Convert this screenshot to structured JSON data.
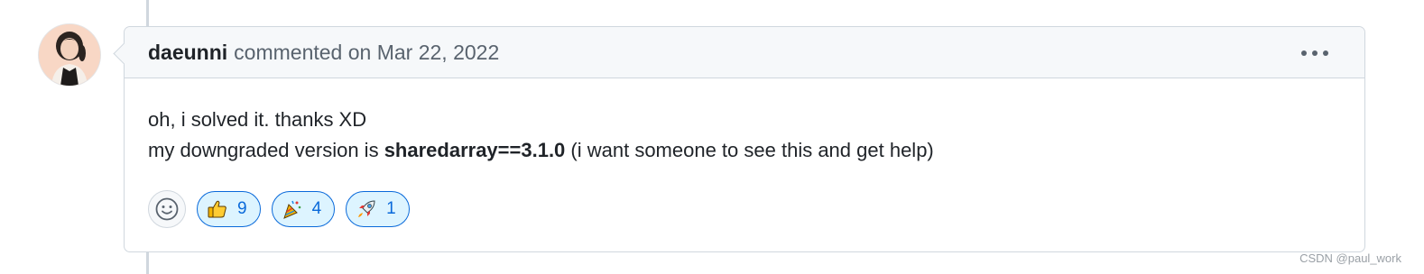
{
  "comment": {
    "author": "daeunni",
    "meta": "commented on Mar 22, 2022",
    "body": {
      "line1": "oh, i solved it. thanks XD",
      "line2_prefix": "my downgraded version is ",
      "line2_strong": "sharedarray==3.1.0",
      "line2_suffix": " (i want someone to see this and get help)"
    },
    "more_icon": "kebab-horizontal-icon",
    "add_reaction_icon": "smiley-icon",
    "reactions": [
      {
        "icon": "thumbs-up-icon",
        "count": "9"
      },
      {
        "icon": "party-popper-icon",
        "count": "4"
      },
      {
        "icon": "rocket-icon",
        "count": "1"
      }
    ]
  },
  "watermark": "CSDN @paul_work",
  "colors": {
    "header_bg": "#f6f8fa",
    "border": "#d0d7de",
    "reaction_active_border": "#0969da",
    "reaction_active_bg": "#ddf4ff"
  }
}
